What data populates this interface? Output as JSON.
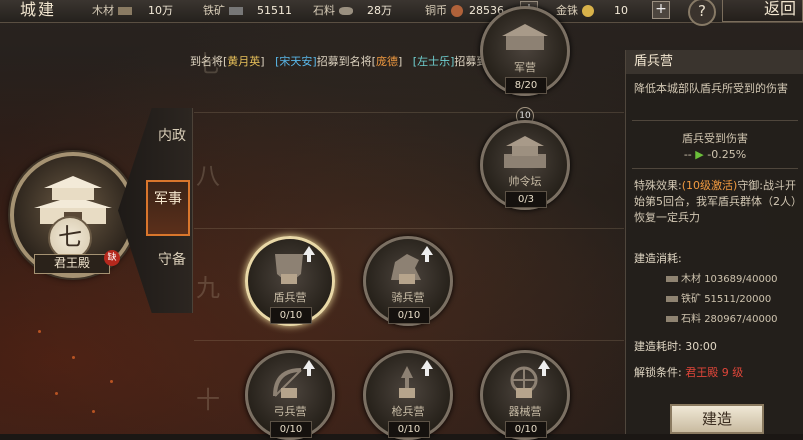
{
  "topbar": {
    "title": "城建",
    "resources": [
      {
        "label": "木材",
        "value": "10万",
        "icon": "wood-icon"
      },
      {
        "label": "铁矿",
        "value": "51511",
        "icon": "iron-icon"
      },
      {
        "label": "石料",
        "value": "28万",
        "icon": "stone-icon"
      },
      {
        "label": "铜币",
        "value": "28536",
        "icon": "copper-coin-icon"
      },
      {
        "label": "金铢",
        "value": "10",
        "icon": "gold-coin-icon"
      }
    ],
    "help_label": "?",
    "back_label": "返回"
  },
  "ticker": {
    "seg1": "到名将[",
    "name1": "黄月英",
    "seg2": "]",
    "name2": "[宋天安]",
    "seg3": "招募到名将[",
    "name3": "庞德",
    "seg4": "]",
    "name4": "[左士乐]",
    "seg5": "招募到名"
  },
  "palace": {
    "level": "七",
    "name": "君王殿",
    "lack_badge": "缺"
  },
  "tabs": {
    "neizheng": "内政",
    "junshi": "军事",
    "shoubei": "守备"
  },
  "rows": {
    "top_digit": "七",
    "eight": "八",
    "nine": "九",
    "ten": "十"
  },
  "buildings": {
    "junying": {
      "name": "军营",
      "count": "8/20"
    },
    "shuailingtan": {
      "name": "帅令坛",
      "count": "0/3"
    },
    "dunbingying": {
      "name": "盾兵营",
      "count": "0/10"
    },
    "qibingying": {
      "name": "骑兵营",
      "count": "0/10"
    },
    "gongbingying": {
      "name": "弓兵营",
      "count": "0/10"
    },
    "qiangbingying": {
      "name": "枪兵营",
      "count": "0/10"
    },
    "qixieying": {
      "name": "器械营",
      "count": "0/10"
    },
    "req_badge": "10"
  },
  "panel": {
    "title": "盾兵营",
    "description": "降低本城部队盾兵所受到的伤害",
    "effect_title": "盾兵受到伤害",
    "effect_from": "--",
    "effect_to": "-0.25%",
    "special_label": "特殊效果:",
    "special_tag": "(10级激活)",
    "special_text": "守御:战斗开始第5回合，我军盾兵群体（2人）恢复一定兵力",
    "cost_label": "建造消耗:",
    "costs": [
      {
        "label": "木材",
        "value": "103689/40000"
      },
      {
        "label": "铁矿",
        "value": "51511/20000"
      },
      {
        "label": "石料",
        "value": "280967/40000"
      }
    ],
    "time_label": "建造耗时:",
    "time_value": "30:00",
    "unlock_label": "解锁条件:",
    "unlock_value": "君王殿 9 级",
    "build_button": "建造"
  },
  "colors": {
    "highlight_orange": "#f09a40",
    "highlight_blue": "#59b7e8",
    "unlock_red": "#e0463a",
    "effect_green": "#6bbf3a"
  }
}
